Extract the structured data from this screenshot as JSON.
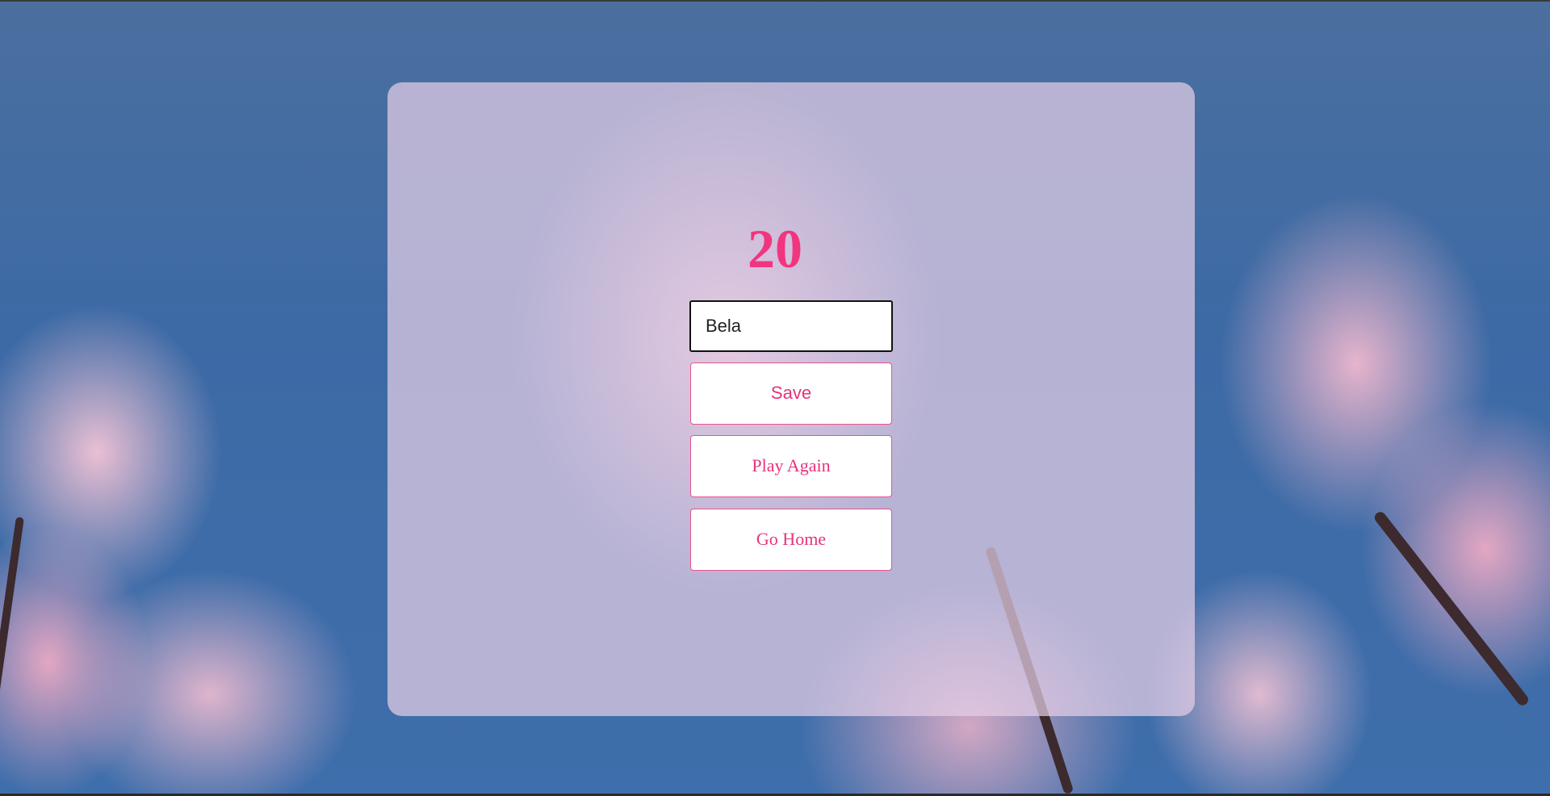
{
  "game_over": {
    "score": "20",
    "name_input": {
      "value": "Bela",
      "placeholder": ""
    },
    "buttons": {
      "save": "Save",
      "play_again": "Play Again",
      "go_home": "Go Home"
    }
  },
  "theme": {
    "accent": "#f2357f",
    "button_text": "#e6337c",
    "button_border": "#e8538f",
    "panel_bg": "#e4cee6",
    "sky": "#3e6eab"
  },
  "background": {
    "description_icon": "cherry-blossom-image"
  }
}
